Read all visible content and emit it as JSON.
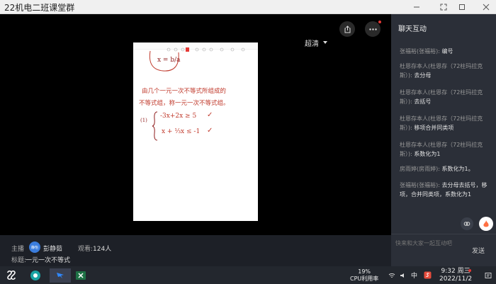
{
  "window": {
    "title": "22机电二班课堂群"
  },
  "player": {
    "quality_label": "超清",
    "slide": {
      "eq_frac": "x = b/a",
      "text_line1": "由几个一元一次不等式所组成的",
      "text_line2": "不等式组，称一元一次不等式组。",
      "item_label": "(1)",
      "ineq1": "-3x+2x ≥ 5",
      "ineq2": "x + ⅓x ≤ -1",
      "check": "✓"
    }
  },
  "info": {
    "host_label": "主播",
    "host_avatar_text": "静怡",
    "host_name": "彭静茹",
    "viewers_label": "观看:",
    "viewers_count": "124人",
    "topic_label": "标题:",
    "topic_value": "一元一次不等式"
  },
  "chat": {
    "title": "聊天互动",
    "messages": [
      {
        "sender": "张福裕(张福裕):",
        "text": "编号"
      },
      {
        "sender": "杜恩存本人(杜恩存（72柱玛拉克斯）):",
        "text": "去分母"
      },
      {
        "sender": "杜恩存本人(杜恩存（72柱玛拉克斯）):",
        "text": "去括号"
      },
      {
        "sender": "杜恩存本人(杜恩存（72柱玛拉克斯）):",
        "text": "移项合并同类项"
      },
      {
        "sender": "杜恩存本人(杜恩存（72柱玛拉克斯）):",
        "text": "系数化为1"
      },
      {
        "sender": "房雨婷(房雨婷):",
        "text": "系数化为1。"
      },
      {
        "sender": "张福裕(张福裕):",
        "text": "去分母去括号，移项，合并同类项，系数化为1"
      }
    ],
    "input_placeholder": "快来和大家一起互动吧",
    "send_label": "发送"
  },
  "taskbar": {
    "cpu_percent": "19%",
    "cpu_label": "CPU利用率",
    "ime": "中",
    "time": "9:32 周三",
    "date": "2022/11/2"
  },
  "colors": {
    "accent": "#3b7ddd",
    "ink_red": "#c0392b",
    "chat_bg": "#2b2f38",
    "info_bg": "#1d2027"
  }
}
